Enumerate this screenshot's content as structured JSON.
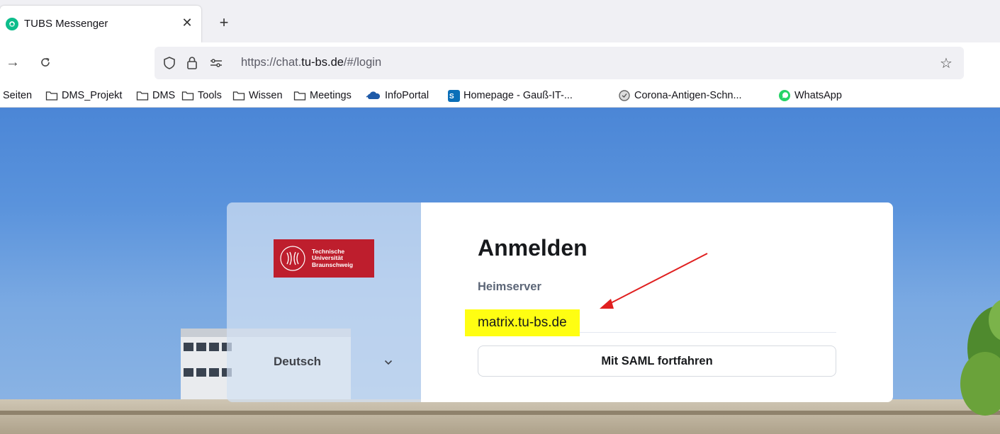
{
  "browser": {
    "tab": {
      "title": "TUBS Messenger"
    },
    "url": {
      "prefix": "https://chat.",
      "host": "tu-bs.de",
      "suffix": "/#/login"
    },
    "bookmarks": [
      {
        "label": "Seiten",
        "icon": "none"
      },
      {
        "label": "DMS_Projekt",
        "icon": "folder-icon"
      },
      {
        "label": "DMS",
        "icon": "folder-icon"
      },
      {
        "label": "Tools",
        "icon": "folder-icon"
      },
      {
        "label": "Wissen",
        "icon": "folder-icon"
      },
      {
        "label": "Meetings",
        "icon": "folder-icon"
      },
      {
        "label": "InfoPortal",
        "icon": "cloud-icon"
      },
      {
        "label": "Homepage - Gauß-IT-...",
        "icon": "sharepoint-icon"
      },
      {
        "label": "Corona-Antigen-Schn...",
        "icon": "shield-icon"
      },
      {
        "label": "WhatsApp",
        "icon": "whatsapp-icon"
      }
    ]
  },
  "login": {
    "logo_lines": [
      "Technische",
      "Universität",
      "Braunschweig"
    ],
    "language": "Deutsch",
    "title": "Anmelden",
    "server_label": "Heimserver",
    "server_value": "matrix.tu-bs.de",
    "saml_button": "Mit SAML fortfahren"
  },
  "colors": {
    "brand_red": "#be1e2d",
    "highlight": "#fffe12",
    "arrow": "#e02020",
    "element_green": "#0dbd8b"
  }
}
